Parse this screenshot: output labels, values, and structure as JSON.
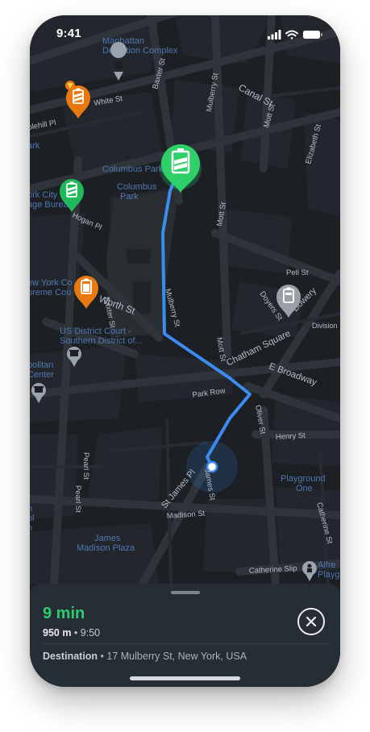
{
  "status_bar": {
    "time": "9:41"
  },
  "map": {
    "labels": {
      "manhattan_detention": "Manhattan\nDetention Complex",
      "white_st": "White St",
      "baxter_st_top": "Baxter St",
      "canal_st": "Canal St",
      "mulberry_st_top": "Mulberry St",
      "mott_st_top": "Mott St",
      "elizabeth_st": "Elizabeth St",
      "columbus_park_label": "Columbus Park",
      "columbus_park_area": "Columbus\nPark",
      "york_city_bureau": "ork City\nage Bureau",
      "hogan_pl": "Hogan Pl",
      "mott_st_mid": "Mott St",
      "pell_st": "Pell St",
      "new_york_court": "ew York Co\npreme Cou",
      "baxter_st_mid": "Baxter St",
      "worth_st": "Worth St",
      "doyers_st": "Doyers St",
      "bowery": "Bowery",
      "division": "Division",
      "us_district_court": "US District Court -\nSouthern District of...",
      "mulberry_st_mid": "Mulberry St",
      "mott_st_low": "Mott St",
      "chatham_square": "Chatham Square",
      "e_broadway": "E Broadway",
      "politan_center": "politan\nCenter",
      "park_row": "Park Row",
      "oliver_st": "Oliver St",
      "henry_st": "Henry St",
      "pearl_st_1": "Pearl St",
      "pearl_st_2": "Pearl St",
      "james_st": "James St",
      "st_james_pl": "St James Pl",
      "playground_one": "Playground\nOne",
      "catherine_st": "Catherine St",
      "madison_st": "Madison St",
      "left_edge_partial": "n\nol\nn",
      "james_madison_plaza": "James\nMadison Plaza",
      "catherine_slip": "Catherine Slip",
      "alfred_playground": "Alfre\nPlayg",
      "blehill_pl": "blehill Pl",
      "ark": "ark"
    },
    "colors": {
      "route": "#3b8cf0",
      "active_pin": "#2fd06a",
      "green_pin": "#1fb85a",
      "orange_pin": "#e9790e",
      "gray_pin": "#9aa0a6",
      "water_label": "#4f77b0"
    },
    "pins": [
      "battery-active",
      "battery-green",
      "battery-orange-fav",
      "battery-orange",
      "battery-gray"
    ]
  },
  "route_panel": {
    "duration": "9 min",
    "distance": "950 m",
    "arrival": "9:50",
    "destination_label": "Destination",
    "destination_address": "17 Mulberry St, New York, USA"
  }
}
